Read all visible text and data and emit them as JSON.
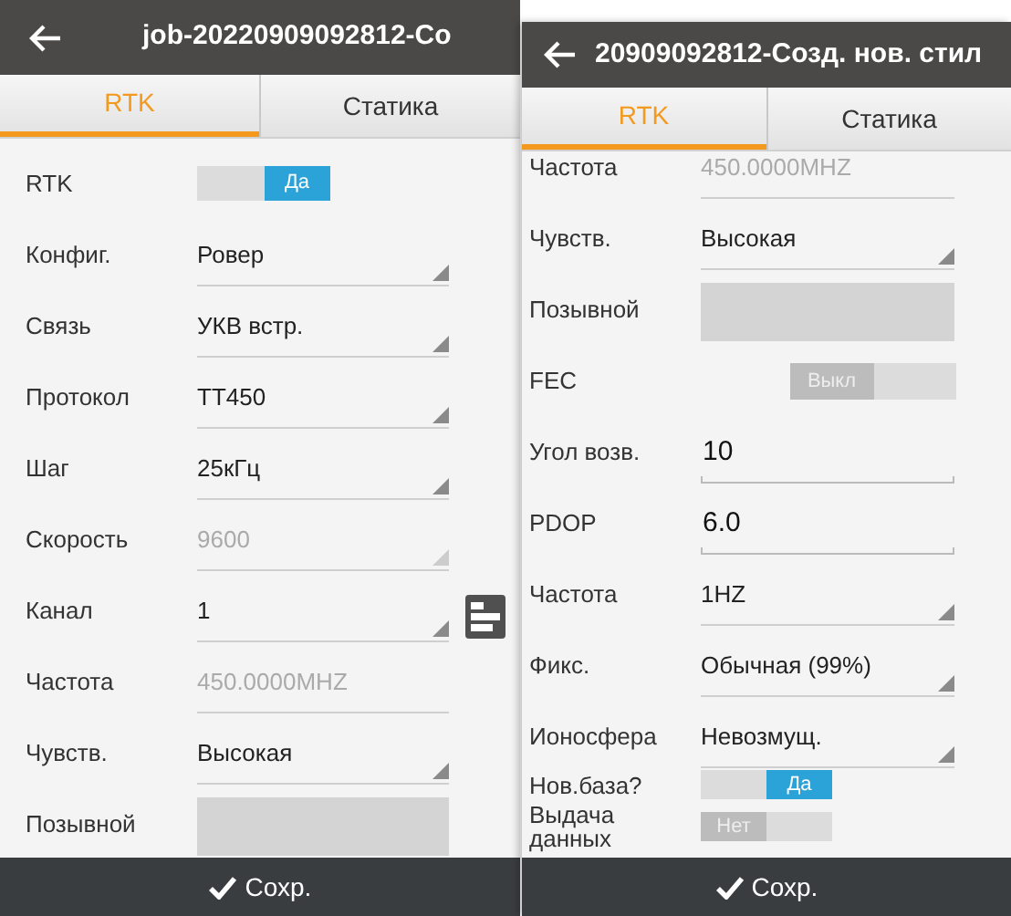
{
  "screens": [
    {
      "title": "job-20220909092812-Со",
      "tabs": [
        {
          "label": "RTK",
          "selected": true
        },
        {
          "label": "Статика",
          "selected": false
        }
      ],
      "rows": [
        {
          "kind": "toggle",
          "label": "RTK",
          "on": true,
          "state_text": "Да"
        },
        {
          "kind": "dropdown",
          "label": "Конфиг.",
          "value": "Ровер",
          "disabled": false
        },
        {
          "kind": "dropdown",
          "label": "Связь",
          "value": "УКВ встр.",
          "disabled": false
        },
        {
          "kind": "dropdown",
          "label": "Протокол",
          "value": "TT450",
          "disabled": false
        },
        {
          "kind": "dropdown",
          "label": "Шаг",
          "value": "25кГц",
          "disabled": false
        },
        {
          "kind": "dropdown",
          "label": "Скорость",
          "value": "9600",
          "disabled": true
        },
        {
          "kind": "dropdown",
          "label": "Канал",
          "value": "1",
          "disabled": false
        },
        {
          "kind": "text",
          "label": "Частота",
          "value": "450.0000MHZ",
          "disabled": true
        },
        {
          "kind": "dropdown",
          "label": "Чувств.",
          "value": "Высокая",
          "disabled": false
        },
        {
          "kind": "blank",
          "label": "Позывной"
        }
      ],
      "save_button": "Сохр."
    },
    {
      "title": "20909092812-Созд. нов. стил",
      "tabs": [
        {
          "label": "RTK",
          "selected": true
        },
        {
          "label": "Статика",
          "selected": false
        }
      ],
      "rows": [
        {
          "kind": "text",
          "label": "Частота",
          "value": "450.0000MHZ",
          "disabled": true
        },
        {
          "kind": "dropdown",
          "label": "Чувств.",
          "value": "Высокая",
          "disabled": false
        },
        {
          "kind": "blank",
          "label": "Позывной"
        },
        {
          "kind": "wide_toggle",
          "label": "FEC",
          "on": false,
          "state_text": "Выкл"
        },
        {
          "kind": "input",
          "label": "Угол возв.",
          "value": "10"
        },
        {
          "kind": "input",
          "label": "PDOP",
          "value": "6.0"
        },
        {
          "kind": "dropdown",
          "label": "Частота",
          "value": "1HZ",
          "disabled": false
        },
        {
          "kind": "dropdown",
          "label": "Фикс.",
          "value": "Обычная (99%)",
          "disabled": false
        },
        {
          "kind": "dropdown",
          "label": "Ионосфера",
          "value": "Невозмущ.",
          "disabled": false
        },
        {
          "kind": "mini_toggle",
          "label": "Нов.база?",
          "on": true,
          "state_text": "Да"
        },
        {
          "kind": "mini_toggle",
          "label": "Выдача данных",
          "on": false,
          "state_text": "Нет"
        }
      ],
      "save_button": "Сохр."
    }
  ]
}
